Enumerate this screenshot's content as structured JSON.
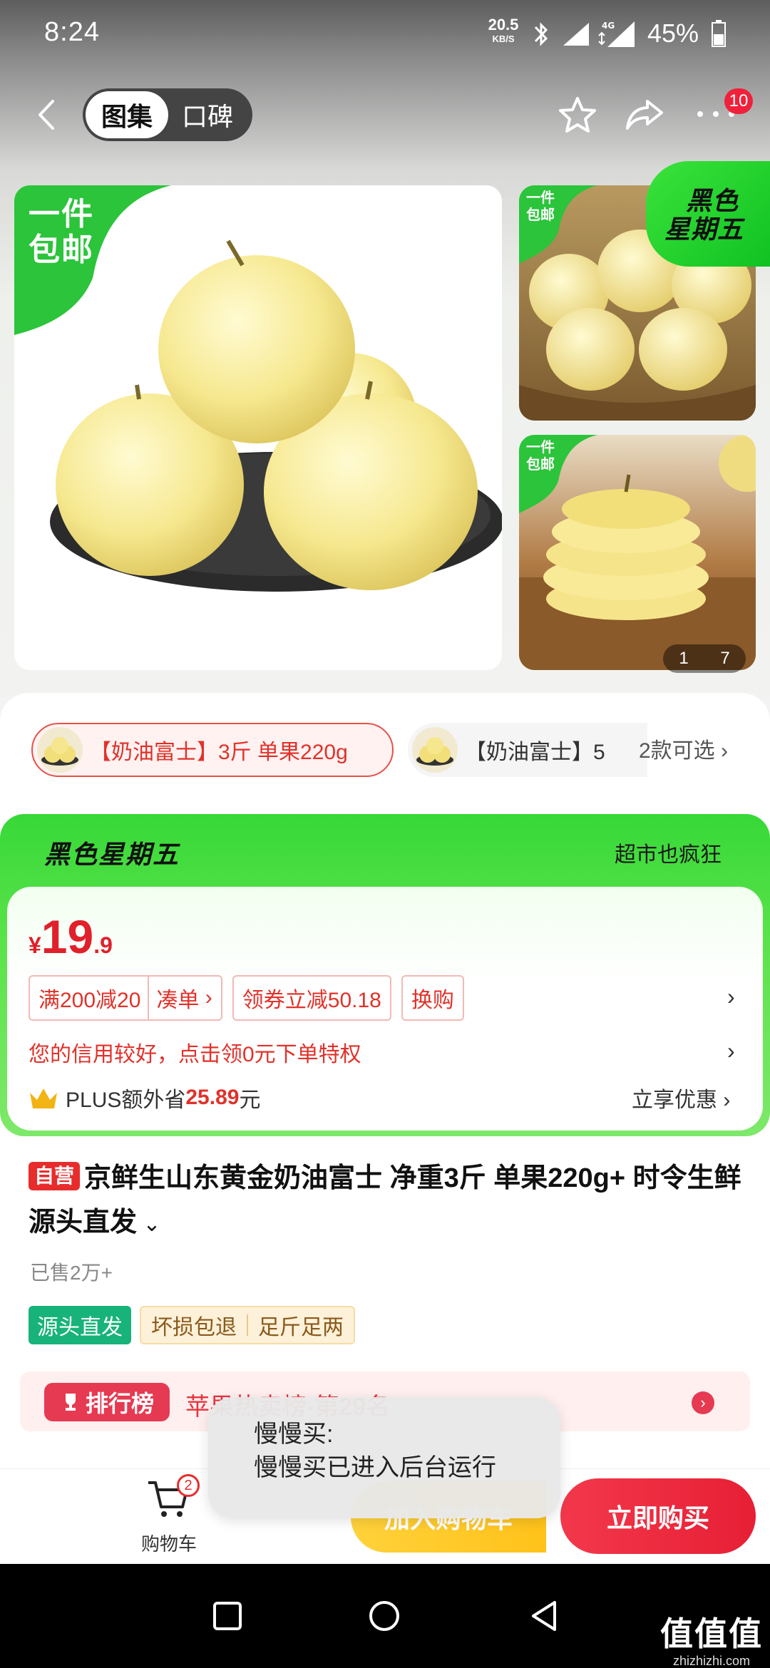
{
  "status_bar": {
    "time": "8:24",
    "speed_value": "20.5",
    "speed_unit": "KB/S",
    "network": "4G",
    "battery": "45%"
  },
  "nav": {
    "tabs": [
      {
        "label": "图集",
        "active": true
      },
      {
        "label": "口碑",
        "active": false
      }
    ],
    "badge_count": "10"
  },
  "gallery": {
    "main_tag": [
      "一件",
      "包邮"
    ],
    "thumb_tag": [
      "一件",
      "包邮"
    ],
    "event_badge": [
      "黑色",
      "星期五"
    ],
    "page_indicator": {
      "current": "1",
      "total": "7"
    }
  },
  "variants": {
    "selected_label": "【奶油富士】3斤 单果220g",
    "other_label": "【奶油富士】5",
    "more_label": "2款可选"
  },
  "promo": {
    "event_title": "黑色星期五",
    "slogan": "超市也疯狂",
    "price_currency": "¥",
    "price_int": "19",
    "price_dec": ".9",
    "coupons": {
      "discount": "满200减20",
      "gather": "凑单",
      "voucher": "领券立减50.18",
      "swap": "换购"
    },
    "credit_text": "您的信用较好，点击领0元下单特权",
    "plus_prefix": "PLUS额外省",
    "plus_amount": "25.89",
    "plus_suffix": "元",
    "plus_right": "立享优惠"
  },
  "product": {
    "self_tag": "自营",
    "title": "京鲜生山东黄金奶油富士 净重3斤 单果220g+ 时令生鲜 源头直发",
    "sold": "已售2万+",
    "tag_green": "源头直发",
    "tag_service_1": "坏损包退",
    "tag_service_2": "足斤足两"
  },
  "ranking": {
    "pill": "排行榜",
    "text": "苹果热卖榜·第29名"
  },
  "toast": {
    "title": "慢慢买:",
    "message": "慢慢买已进入后台运行"
  },
  "bottom": {
    "cart_label": "购物车",
    "cart_count": "2",
    "add_to_cart": "加入购物车",
    "buy_now": "立即购买"
  },
  "watermark": {
    "main": "值值值",
    "sub": "zhizhizhi.com"
  },
  "colors": {
    "accent_red": "#e0202a",
    "promo_green": "#37d838",
    "buy_red": "#e71f35",
    "cart_yellow": "#ffc21a"
  },
  "icons": [
    "back-icon",
    "star-icon",
    "share-icon",
    "more-icon",
    "cart-icon",
    "crown-icon",
    "trophy-icon",
    "bluetooth-icon",
    "signal-icon",
    "battery-icon"
  ]
}
